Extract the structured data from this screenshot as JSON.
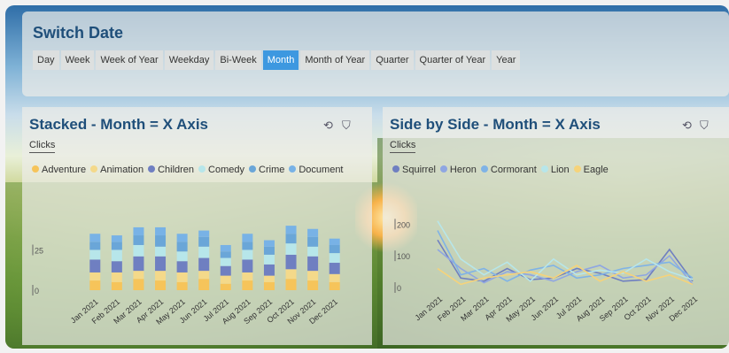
{
  "switch": {
    "title": "Switch Date",
    "tabs": [
      "Day",
      "Week",
      "Week of Year",
      "Weekday",
      "Bi-Week",
      "Month",
      "Month of Year",
      "Quarter",
      "Quarter of Year",
      "Year"
    ],
    "active_tab": "Month"
  },
  "colors": {
    "Adventure": "#f6c45a",
    "Animation": "#f4d98a",
    "Children": "#6f7fc1",
    "Comedy": "#b7e6ea",
    "Crime": "#6aa6d8",
    "Document": "#78b2e6",
    "Squirrel": "#6f7fc1",
    "Heron": "#8fa6e2",
    "Cormorant": "#7fb3e6",
    "Lion": "#b7e6ea",
    "Eagle": "#f6d37a"
  },
  "left_panel": {
    "title": "Stacked - Month = X Axis",
    "subtitle": "Clicks",
    "refresh_icon": "refresh-icon",
    "filter_icon": "filter-icon",
    "legend": [
      "Adventure",
      "Animation",
      "Children",
      "Comedy",
      "Crime",
      "Document"
    ]
  },
  "right_panel": {
    "title": "Side by Side - Month = X Axis",
    "subtitle": "Clicks",
    "refresh_icon": "refresh-icon",
    "filter_icon": "filter-icon",
    "legend": [
      "Squirrel",
      "Heron",
      "Cormorant",
      "Lion",
      "Eagle"
    ]
  },
  "chart_data": [
    {
      "type": "bar",
      "stacked": true,
      "categories": [
        "Jan 2021",
        "Feb 2021",
        "Mar 2021",
        "Apr 2021",
        "May 2021",
        "Jun 2021",
        "Jul 2021",
        "Aug 2021",
        "Sep 2021",
        "Oct 2021",
        "Nov 2021",
        "Dec 2021"
      ],
      "yticks": [
        0,
        25
      ],
      "ylim": [
        0,
        45
      ],
      "series": [
        {
          "name": "Adventure",
          "values": [
            6,
            5,
            7,
            6,
            5,
            7,
            4,
            6,
            5,
            7,
            6,
            5
          ]
        },
        {
          "name": "Animation",
          "values": [
            5,
            6,
            5,
            6,
            6,
            5,
            5,
            5,
            4,
            6,
            6,
            5
          ]
        },
        {
          "name": "Children",
          "values": [
            8,
            7,
            9,
            9,
            7,
            8,
            6,
            8,
            7,
            9,
            9,
            7
          ]
        },
        {
          "name": "Comedy",
          "values": [
            6,
            7,
            7,
            6,
            6,
            7,
            5,
            6,
            6,
            7,
            6,
            6
          ]
        },
        {
          "name": "Crime",
          "values": [
            5,
            5,
            6,
            7,
            6,
            6,
            4,
            5,
            5,
            6,
            6,
            5
          ]
        },
        {
          "name": "Document",
          "values": [
            5,
            4,
            5,
            5,
            5,
            4,
            4,
            5,
            4,
            5,
            5,
            4
          ]
        }
      ]
    },
    {
      "type": "line",
      "categories": [
        "Jan 2021",
        "Feb 2021",
        "Mar 2021",
        "Apr 2021",
        "May 2021",
        "Jun 2021",
        "Jul 2021",
        "Aug 2021",
        "Sep 2021",
        "Oct 2021",
        "Nov 2021",
        "Dec 2021"
      ],
      "yticks": [
        0,
        100,
        200
      ],
      "ylim": [
        0,
        240
      ],
      "series": [
        {
          "name": "Squirrel",
          "values": [
            150,
            30,
            20,
            60,
            25,
            30,
            60,
            45,
            20,
            25,
            120,
            20
          ]
        },
        {
          "name": "Heron",
          "values": [
            120,
            60,
            15,
            50,
            40,
            20,
            50,
            70,
            30,
            40,
            100,
            10
          ]
        },
        {
          "name": "Cormorant",
          "values": [
            180,
            40,
            60,
            20,
            55,
            70,
            30,
            40,
            60,
            70,
            80,
            30
          ]
        },
        {
          "name": "Lion",
          "values": [
            210,
            90,
            40,
            80,
            20,
            90,
            40,
            55,
            45,
            90,
            50,
            25
          ]
        },
        {
          "name": "Eagle",
          "values": [
            60,
            10,
            30,
            40,
            50,
            30,
            70,
            20,
            50,
            20,
            40,
            10
          ]
        }
      ]
    }
  ]
}
